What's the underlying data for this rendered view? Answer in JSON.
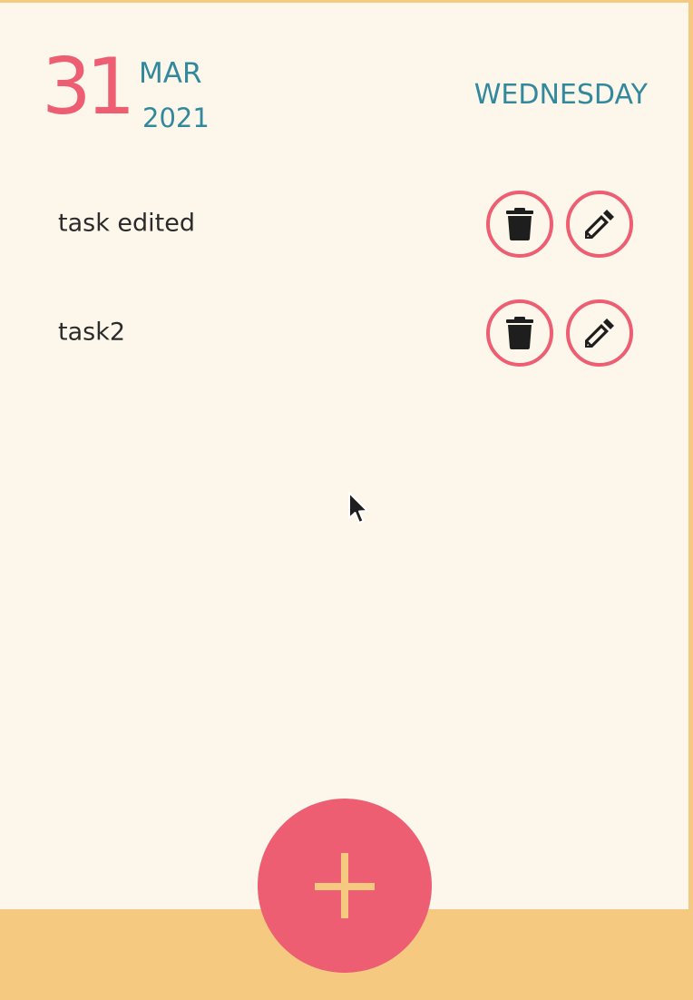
{
  "date": {
    "day": "31",
    "month": "MAR",
    "year": "2021",
    "weekday": "WEDNESDAY"
  },
  "tasks": [
    {
      "label": "task edited"
    },
    {
      "label": "task2"
    }
  ],
  "icons": {
    "delete": "trash-icon",
    "edit": "pencil-icon",
    "add": "plus-icon"
  },
  "colors": {
    "accent": "#ed5e73",
    "primary_text": "#32889c",
    "background": "#fcf7ea",
    "frame": "#f5c97f",
    "icon_dark": "#1e1e1e"
  }
}
